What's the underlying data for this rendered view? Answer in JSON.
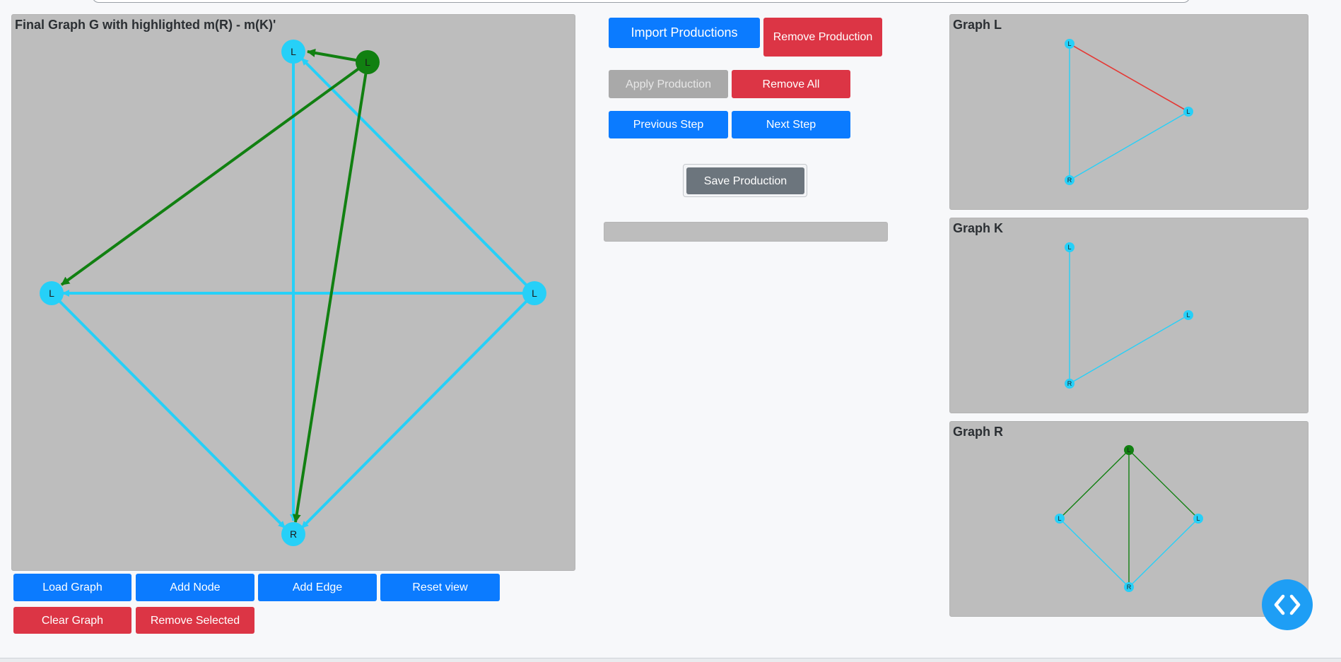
{
  "main_panel": {
    "title": "Final Graph G with highlighted m(R) - m(K)'",
    "nodes": [
      {
        "id": "top",
        "label": "L",
        "color": "#26d0f8"
      },
      {
        "id": "green",
        "label": "L",
        "color": "#118011"
      },
      {
        "id": "left",
        "label": "L",
        "color": "#26d0f8"
      },
      {
        "id": "right",
        "label": "L",
        "color": "#26d0f8"
      },
      {
        "id": "bottom",
        "label": "R",
        "color": "#26d0f8"
      }
    ]
  },
  "graph_buttons": {
    "load_graph": "Load Graph",
    "add_node": "Add Node",
    "add_edge": "Add Edge",
    "reset_view": "Reset view",
    "clear_graph": "Clear Graph",
    "remove_selected": "Remove Selected"
  },
  "production_controls": {
    "import_productions": "Import Productions",
    "remove_production": "Remove Production",
    "apply_production": "Apply Production",
    "remove_all": "Remove All",
    "previous_step": "Previous Step",
    "next_step": "Next Step",
    "save_production": "Save Production"
  },
  "side_graphs": {
    "graph_l": {
      "title": "Graph L",
      "labels": [
        "L",
        "L",
        "R"
      ]
    },
    "graph_k": {
      "title": "Graph K",
      "labels": [
        "L",
        "L",
        "R"
      ]
    },
    "graph_r": {
      "title": "Graph R",
      "labels": [
        "L",
        "L",
        "L",
        "R"
      ]
    }
  },
  "colors": {
    "cyan": "#26d0f8",
    "green": "#118011",
    "red": "#e53935",
    "blue_button": "#0b7bff",
    "red_button": "#dc3545",
    "panel_bg": "#bdbdbd"
  },
  "icons": {
    "code_toggle": "code-brackets-icon"
  }
}
